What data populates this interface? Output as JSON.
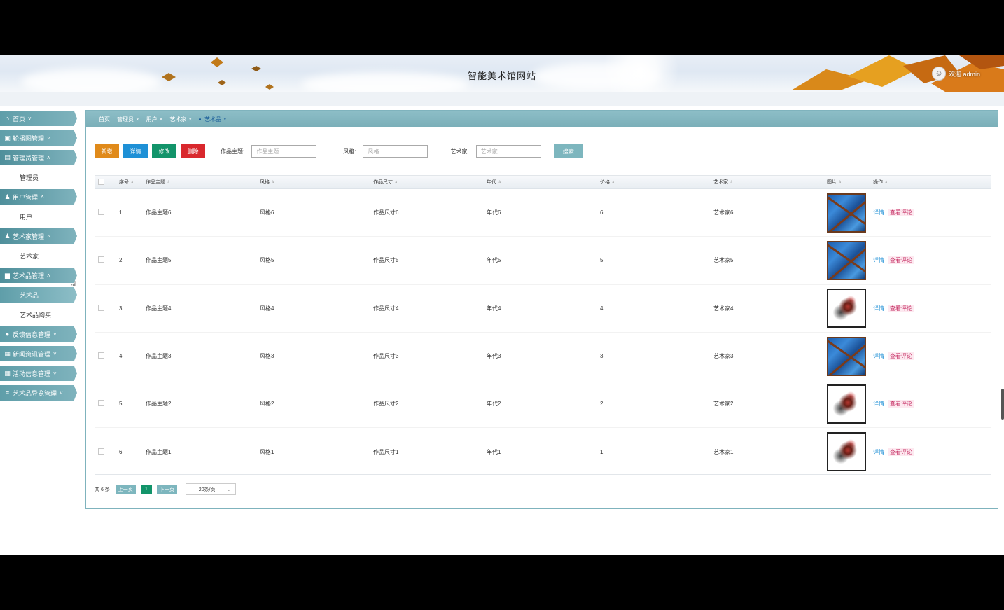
{
  "header": {
    "site_title": "智能美术馆网站",
    "welcome": "欢迎 admin"
  },
  "sidebar": {
    "items": [
      {
        "label": "首页",
        "icon": "home-icon",
        "type": "head"
      },
      {
        "label": "轮播图管理",
        "icon": "image-icon",
        "type": "head"
      },
      {
        "label": "管理员管理",
        "icon": "table-icon",
        "type": "head",
        "open": true
      },
      {
        "label": "管理员",
        "type": "sub"
      },
      {
        "label": "用户管理",
        "icon": "user-icon",
        "type": "head",
        "open": true
      },
      {
        "label": "用户",
        "type": "sub"
      },
      {
        "label": "艺术家管理",
        "icon": "user-icon",
        "type": "head",
        "open": true
      },
      {
        "label": "艺术家",
        "type": "sub"
      },
      {
        "label": "艺术品管理",
        "icon": "file-icon",
        "type": "head",
        "open": true
      },
      {
        "label": "艺术品",
        "type": "sub",
        "active": true
      },
      {
        "label": "艺术品购买",
        "type": "sub"
      },
      {
        "label": "反馈信息管理",
        "icon": "circle-icon",
        "type": "head"
      },
      {
        "label": "新闻资讯管理",
        "icon": "news-icon",
        "type": "head"
      },
      {
        "label": "活动信息管理",
        "icon": "grid-icon",
        "type": "head"
      },
      {
        "label": "艺术品导览管理",
        "icon": "list-icon",
        "type": "head"
      }
    ]
  },
  "tabs": [
    {
      "label": "首页",
      "closable": false
    },
    {
      "label": "管理员",
      "closable": true
    },
    {
      "label": "用户",
      "closable": true
    },
    {
      "label": "艺术家",
      "closable": true
    },
    {
      "label": "艺术品",
      "closable": true,
      "active": true
    }
  ],
  "toolbar": {
    "add_label": "新增",
    "detail_label": "详情",
    "edit_label": "修改",
    "delete_label": "删除",
    "search_label": "搜索"
  },
  "filters": [
    {
      "label": "作品主题:",
      "placeholder": "作品主题"
    },
    {
      "label": "风格:",
      "placeholder": "风格"
    },
    {
      "label": "艺术家:",
      "placeholder": "艺术家"
    }
  ],
  "table": {
    "columns": [
      "序号",
      "作品主题",
      "风格",
      "作品尺寸",
      "年代",
      "价格",
      "艺术家",
      "图片",
      "操作"
    ],
    "rows": [
      {
        "no": "1",
        "theme": "作品主题6",
        "style": "风格6",
        "size": "作品尺寸6",
        "era": "年代6",
        "price": "6",
        "artist": "艺术家6",
        "image": "blue"
      },
      {
        "no": "2",
        "theme": "作品主题5",
        "style": "风格5",
        "size": "作品尺寸5",
        "era": "年代5",
        "price": "5",
        "artist": "艺术家5",
        "image": "blue"
      },
      {
        "no": "3",
        "theme": "作品主题4",
        "style": "风格4",
        "size": "作品尺寸4",
        "era": "年代4",
        "price": "4",
        "artist": "艺术家4",
        "image": "deer"
      },
      {
        "no": "4",
        "theme": "作品主题3",
        "style": "风格3",
        "size": "作品尺寸3",
        "era": "年代3",
        "price": "3",
        "artist": "艺术家3",
        "image": "blue"
      },
      {
        "no": "5",
        "theme": "作品主题2",
        "style": "风格2",
        "size": "作品尺寸2",
        "era": "年代2",
        "price": "2",
        "artist": "艺术家2",
        "image": "deer"
      },
      {
        "no": "6",
        "theme": "作品主题1",
        "style": "风格1",
        "size": "作品尺寸1",
        "era": "年代1",
        "price": "1",
        "artist": "艺术家1",
        "image": "deer"
      }
    ],
    "view_label": "详情",
    "comment_label": "查看评论"
  },
  "pager": {
    "total": "共 6 条",
    "prev": "上一页",
    "current": "1",
    "next": "下一页",
    "page_size": "20条/页"
  },
  "colors": {
    "accent": "#7fb3bd",
    "add": "#e08a1a",
    "detail": "#1e90d6",
    "edit": "#12946a",
    "delete": "#d9282d"
  }
}
